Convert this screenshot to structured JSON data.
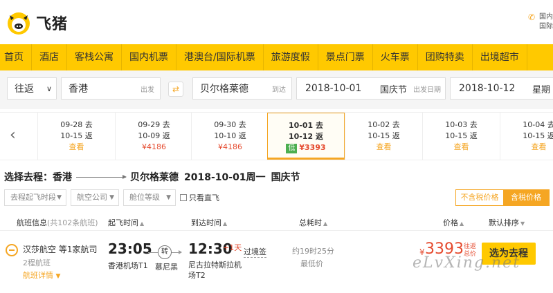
{
  "header": {
    "logo_text": "飞猪",
    "right_lines": [
      "国内",
      "国际"
    ]
  },
  "nav": [
    "首页",
    "酒店",
    "客栈公寓",
    "国内机票",
    "港澳台/国际机票",
    "旅游度假",
    "景点门票",
    "火车票",
    "团购特卖",
    "出境超市"
  ],
  "search": {
    "trip_type": "往返",
    "from_city": "香港",
    "from_hint": "出发",
    "to_city": "贝尔格莱德",
    "to_hint": "到达",
    "depart_date": "2018-10-01",
    "depart_holiday": "国庆节",
    "depart_hint": "出发日期",
    "return_date": "2018-10-12",
    "return_weekday": "星期"
  },
  "date_strip": [
    {
      "go": "09-28 去",
      "back": "10-15 返",
      "price": "查看",
      "red": false,
      "low": "",
      "active": false
    },
    {
      "go": "09-29 去",
      "back": "10-09 返",
      "price": "¥4186",
      "red": true,
      "low": "",
      "active": false
    },
    {
      "go": "09-30 去",
      "back": "10-10 返",
      "price": "¥4186",
      "red": true,
      "low": "",
      "active": false
    },
    {
      "go": "10-01 去",
      "back": "10-12 返",
      "price": "¥3393",
      "red": true,
      "low": "低",
      "active": true
    },
    {
      "go": "10-02 去",
      "back": "10-15 返",
      "price": "查看",
      "red": false,
      "low": "",
      "active": false
    },
    {
      "go": "10-03 去",
      "back": "10-15 返",
      "price": "查看",
      "red": false,
      "low": "",
      "active": false
    },
    {
      "go": "10-04 去",
      "back": "10-15 返",
      "price": "查看",
      "red": false,
      "low": "",
      "active": false
    }
  ],
  "route": {
    "label": "选择去程：香港",
    "dest": "贝尔格莱德",
    "date": "2018-10-01周一",
    "holiday": "国庆节"
  },
  "filters": {
    "dep_period": "去程起飞时段",
    "airline": "航空公司",
    "cabin": "舱位等级",
    "direct_only": "只看直飞",
    "tax_excl": "不含税价格",
    "tax_incl": "含税价格"
  },
  "columns": {
    "flight_info": "航班信息",
    "flight_count": "(共102条航班)",
    "dep_time": "起飞时间",
    "arr_time": "到达时间",
    "duration": "总耗时",
    "price": "价格",
    "sort": "默认排序"
  },
  "flight": {
    "airline": "汉莎航空 等1家航司",
    "stops": "2程航班",
    "details": "航班详情",
    "dep_time": "23:05",
    "dep_airport": "香港机场T1",
    "transfer": "转",
    "via": "慕尼黑",
    "arr_time": "12:30",
    "plus_day": "+1天",
    "visa": "过境签",
    "arr_airport": "尼古拉特斯拉机场T2",
    "duration": "约19时25分",
    "lowest": "最低价",
    "price_symbol": "¥",
    "price": "3393",
    "price_note": "往返总价",
    "book": "选为去程"
  },
  "watermark": "eLvXing.net"
}
